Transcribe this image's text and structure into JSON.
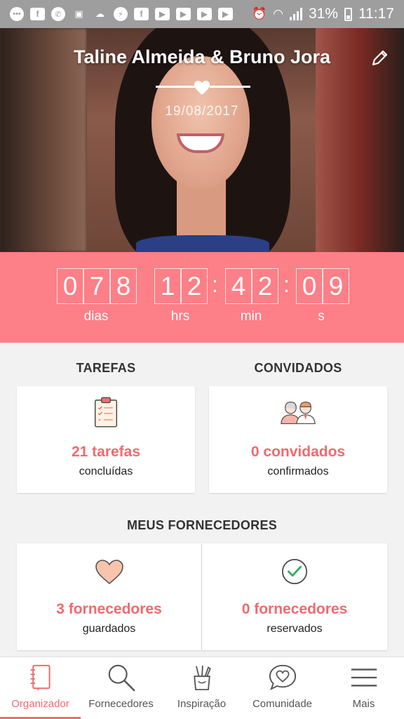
{
  "status_bar": {
    "battery": "31%",
    "time": "11:17"
  },
  "hero": {
    "names": "Taline Almeida & Bruno Jora",
    "date": "19/08/2017"
  },
  "countdown": {
    "days": [
      "0",
      "7",
      "8"
    ],
    "hours": [
      "1",
      "2"
    ],
    "minutes": [
      "4",
      "2"
    ],
    "seconds": [
      "0",
      "9"
    ],
    "separator": ":",
    "labels": {
      "days": "dias",
      "hours": "hrs",
      "minutes": "min",
      "seconds": "s"
    }
  },
  "tasks": {
    "title": "TAREFAS",
    "count": "21 tarefas",
    "sub": "concluídas"
  },
  "guests": {
    "title": "CONVIDADOS",
    "count": "0 convidados",
    "sub": "confirmados"
  },
  "vendors": {
    "title": "MEUS FORNECEDORES",
    "saved": {
      "count": "3 fornecedores",
      "sub": "guardados"
    },
    "reserved": {
      "count": "0 fornecedores",
      "sub": "reservados"
    }
  },
  "nav": {
    "items": [
      {
        "label": "Organizador",
        "icon": "notebook-icon"
      },
      {
        "label": "Fornecedores",
        "icon": "search-icon"
      },
      {
        "label": "Inspiração",
        "icon": "pencil-cup-icon"
      },
      {
        "label": "Comunidade",
        "icon": "chat-heart-icon"
      },
      {
        "label": "Mais",
        "icon": "menu-icon"
      }
    ],
    "active_index": 0
  },
  "colors": {
    "accent": "#ef6b6e",
    "countdown_bg": "#fd7f87",
    "status_bar": "#9e9e9e"
  }
}
